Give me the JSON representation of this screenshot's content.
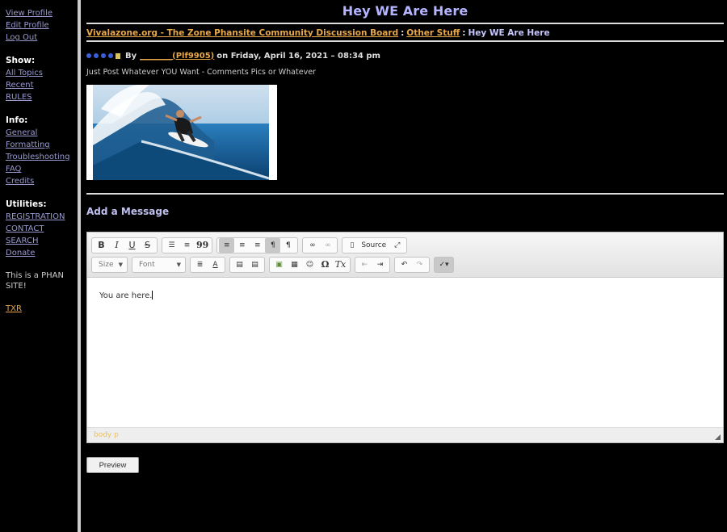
{
  "sidebar": {
    "profile_links": [
      "View Profile",
      "Edit Profile",
      "Log Out"
    ],
    "show_title": "Show:",
    "show_links": [
      "All Topics",
      "Recent",
      "RULES"
    ],
    "info_title": "Info:",
    "info_links": [
      "General",
      "Formatting",
      "Troubleshooting",
      "FAQ",
      "Credits"
    ],
    "utilities_title": "Utilities:",
    "utilities_links": [
      "REGISTRATION",
      "CONTACT",
      "SEARCH",
      "Donate"
    ],
    "note": "This is a PHAN SITE!",
    "txr": "TXR"
  },
  "page": {
    "title": "Hey WE Are Here",
    "breadcrumb": {
      "board": "Vivalazone.org - The Zone Phansite Community Discussion Board",
      "separator": ":",
      "category": "Other Stuff",
      "current": "Hey WE Are Here"
    },
    "post": {
      "by_label": "By",
      "user": "________(Plf9905)",
      "date_text": "on Friday, April 16, 2021 – 08:34 pm",
      "body": "Just Post Whatever YOU Want - Comments Pics or Whatever"
    },
    "add_message_title": "Add a Message"
  },
  "editor": {
    "toolbar": {
      "bold": "B",
      "italic": "I",
      "underline": "U",
      "strike": "S",
      "quote": "99",
      "source_label": "Source",
      "size_label": "Size",
      "font_label": "Font",
      "text_color": "A",
      "special_char": "Ω",
      "remove_format": "Tx"
    },
    "content": "You are here.",
    "status_path": "body  p"
  },
  "preview_label": "Preview",
  "colors": {
    "link_sidebar": "#9a9acf",
    "link_orange": "#e8a84a",
    "title_lavender": "#b4b4ff",
    "background": "#000000"
  }
}
